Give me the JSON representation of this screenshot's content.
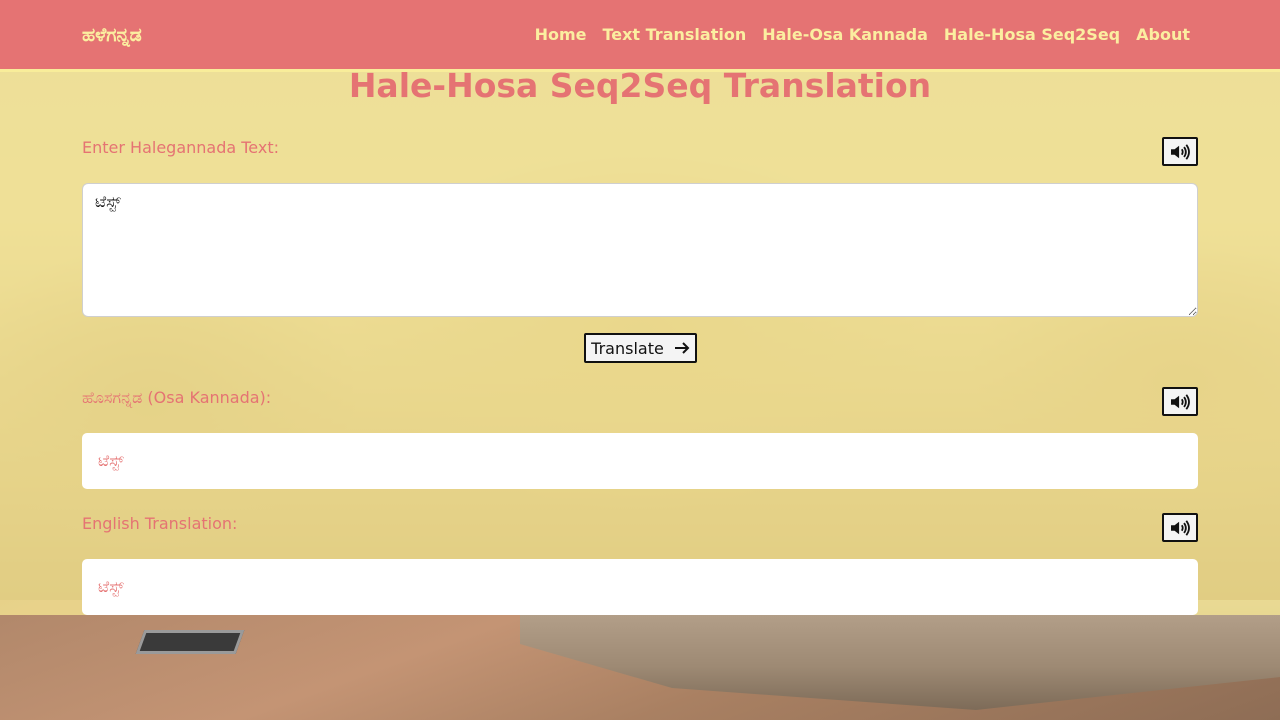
{
  "nav": {
    "brand": "ಹಳೆಗನ್ನಡ",
    "links": [
      "Home",
      "Text Translation",
      "Hale-Osa Kannada",
      "Hale-Hosa Seq2Seq",
      "About"
    ]
  },
  "page": {
    "title": "Hale-Hosa Seq2Seq Translation"
  },
  "input": {
    "label": "Enter Halegannada Text:",
    "value": "ಟೆಸ್ಟ್"
  },
  "translate_button": {
    "label": "Translate",
    "icon": "arrow-right-icon"
  },
  "osa_output": {
    "label": "ಹೊಸಗನ್ನಡ (Osa Kannada):",
    "value": "ಟೆಸ್ಟ್"
  },
  "english_output": {
    "label": "English Translation:",
    "value": "ಟೆಸ್ಟ್"
  },
  "speak_icon": "speaker-icon",
  "colors": {
    "navbar": "#e57373",
    "nav_text": "#fbeea0",
    "accent_text": "#e57373",
    "overlay": "#fcee96"
  }
}
